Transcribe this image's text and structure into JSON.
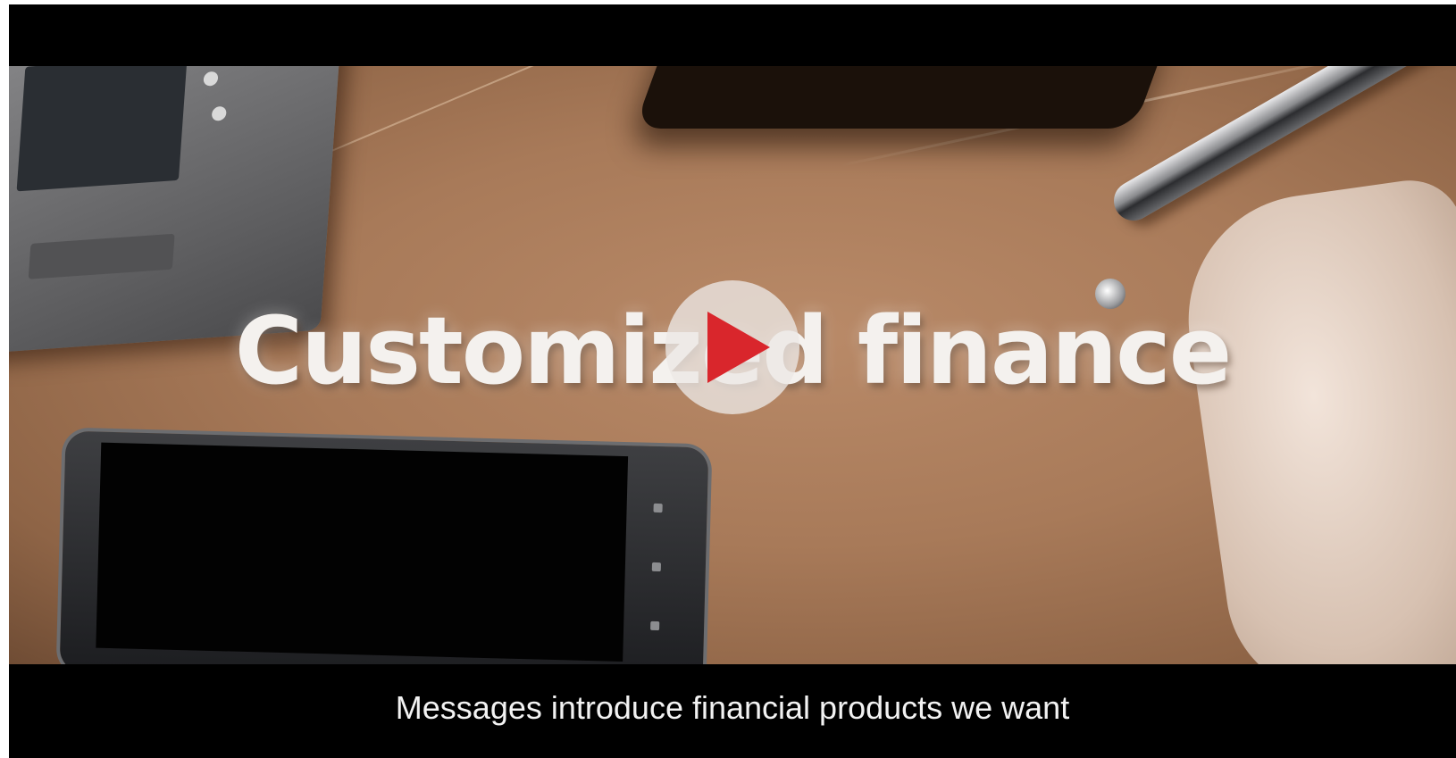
{
  "video": {
    "headline": "Customized finance",
    "subtitle": "Messages introduce financial products we want",
    "play_icon": "play-icon",
    "colors": {
      "play_triangle": "#d9262c",
      "play_circle": "#ece8e6",
      "letterbox": "#000000",
      "subtitle_text": "#f2f2f2"
    }
  }
}
